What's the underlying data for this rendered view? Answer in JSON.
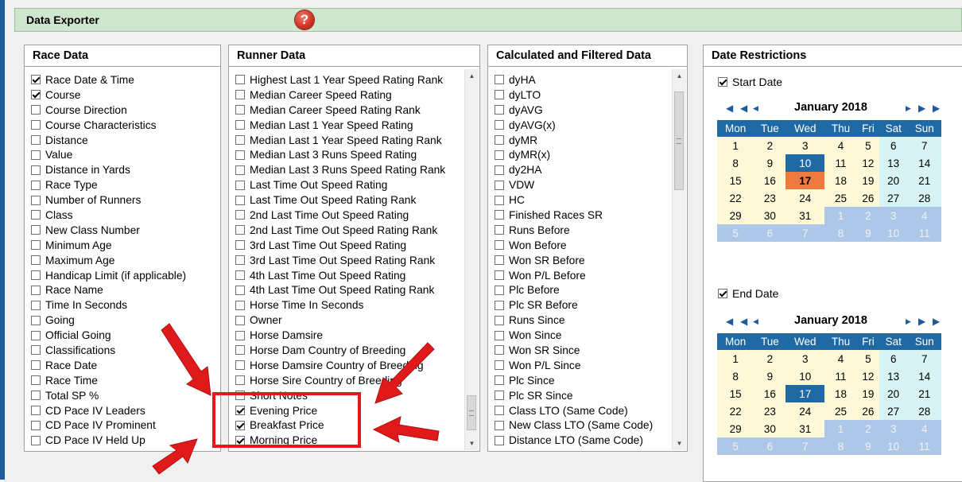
{
  "header": {
    "title": "Data Exporter",
    "help_label": "?"
  },
  "race_data": {
    "title": "Race Data",
    "items": [
      {
        "label": "Race Date & Time",
        "checked": true
      },
      {
        "label": "Course",
        "checked": true
      },
      {
        "label": "Course Direction",
        "checked": false
      },
      {
        "label": "Course Characteristics",
        "checked": false
      },
      {
        "label": "Distance",
        "checked": false
      },
      {
        "label": "Value",
        "checked": false
      },
      {
        "label": "Distance in Yards",
        "checked": false
      },
      {
        "label": "Race Type",
        "checked": false
      },
      {
        "label": "Number of Runners",
        "checked": false
      },
      {
        "label": "Class",
        "checked": false
      },
      {
        "label": "New Class Number",
        "checked": false
      },
      {
        "label": "Minimum Age",
        "checked": false
      },
      {
        "label": "Maximum Age",
        "checked": false
      },
      {
        "label": "Handicap Limit (if applicable)",
        "checked": false
      },
      {
        "label": "Race Name",
        "checked": false
      },
      {
        "label": "Time In Seconds",
        "checked": false
      },
      {
        "label": "Going",
        "checked": false
      },
      {
        "label": "Official Going",
        "checked": false
      },
      {
        "label": "Classifications",
        "checked": false
      },
      {
        "label": "Race Date",
        "checked": false
      },
      {
        "label": "Race Time",
        "checked": false
      },
      {
        "label": "Total SP %",
        "checked": false
      },
      {
        "label": "CD Pace IV Leaders",
        "checked": false
      },
      {
        "label": "CD Pace IV Prominent",
        "checked": false
      },
      {
        "label": "CD Pace IV Held Up",
        "checked": false
      }
    ]
  },
  "runner_data": {
    "title": "Runner Data",
    "items": [
      {
        "label": "Highest Last 1 Year Speed Rating Rank",
        "checked": false
      },
      {
        "label": "Median Career Speed Rating",
        "checked": false
      },
      {
        "label": "Median Career Speed Rating Rank",
        "checked": false
      },
      {
        "label": "Median Last 1 Year Speed Rating",
        "checked": false
      },
      {
        "label": "Median Last 1 Year Speed Rating Rank",
        "checked": false
      },
      {
        "label": "Median Last 3 Runs Speed Rating",
        "checked": false
      },
      {
        "label": "Median Last 3 Runs Speed Rating Rank",
        "checked": false
      },
      {
        "label": "Last Time Out Speed Rating",
        "checked": false
      },
      {
        "label": "Last Time Out Speed Rating Rank",
        "checked": false
      },
      {
        "label": "2nd Last Time Out Speed Rating",
        "checked": false
      },
      {
        "label": "2nd Last Time Out Speed Rating Rank",
        "checked": false
      },
      {
        "label": "3rd Last Time Out Speed Rating",
        "checked": false
      },
      {
        "label": "3rd Last Time Out Speed Rating Rank",
        "checked": false
      },
      {
        "label": "4th Last Time Out Speed Rating",
        "checked": false
      },
      {
        "label": "4th Last Time Out Speed Rating Rank",
        "checked": false
      },
      {
        "label": "Horse Time In Seconds",
        "checked": false
      },
      {
        "label": "Owner",
        "checked": false
      },
      {
        "label": "Horse Damsire",
        "checked": false
      },
      {
        "label": "Horse Dam Country of Breeding",
        "checked": false
      },
      {
        "label": "Horse Damsire Country of Breeding",
        "checked": false
      },
      {
        "label": "Horse Sire Country of Breeding",
        "checked": false
      },
      {
        "label": "Short Notes",
        "checked": false
      },
      {
        "label": "Evening Price",
        "checked": true
      },
      {
        "label": "Breakfast Price",
        "checked": true
      },
      {
        "label": "Morning Price",
        "checked": true
      }
    ]
  },
  "calc_data": {
    "title": "Calculated and Filtered Data",
    "items": [
      {
        "label": "dyHA",
        "checked": false
      },
      {
        "label": "dyLTO",
        "checked": false
      },
      {
        "label": "dyAVG",
        "checked": false
      },
      {
        "label": "dyAVG(x)",
        "checked": false
      },
      {
        "label": "dyMR",
        "checked": false
      },
      {
        "label": "dyMR(x)",
        "checked": false
      },
      {
        "label": "dy2HA",
        "checked": false
      },
      {
        "label": "VDW",
        "checked": false
      },
      {
        "label": "HC",
        "checked": false
      },
      {
        "label": "Finished Races SR",
        "checked": false
      },
      {
        "label": "Runs Before",
        "checked": false
      },
      {
        "label": "Won Before",
        "checked": false
      },
      {
        "label": "Won SR Before",
        "checked": false
      },
      {
        "label": "Won P/L Before",
        "checked": false
      },
      {
        "label": "Plc Before",
        "checked": false
      },
      {
        "label": "Plc SR Before",
        "checked": false
      },
      {
        "label": "Runs Since",
        "checked": false
      },
      {
        "label": "Won Since",
        "checked": false
      },
      {
        "label": "Won SR Since",
        "checked": false
      },
      {
        "label": "Won P/L Since",
        "checked": false
      },
      {
        "label": "Plc Since",
        "checked": false
      },
      {
        "label": "Plc SR Since",
        "checked": false
      },
      {
        "label": "Class LTO (Same Code)",
        "checked": false
      },
      {
        "label": "New Class LTO (Same Code)",
        "checked": false
      },
      {
        "label": "Distance LTO (Same Code)",
        "checked": false
      }
    ]
  },
  "date_restrictions": {
    "title": "Date Restrictions",
    "start": {
      "label": "Start Date",
      "checked": true,
      "month": "January 2018",
      "selected": "10",
      "today": "17"
    },
    "end": {
      "label": "End Date",
      "checked": true,
      "month": "January 2018",
      "selected": "17",
      "today": ""
    },
    "weekdays": [
      "Mon",
      "Tue",
      "Wed",
      "Thu",
      "Fri",
      "Sat",
      "Sun"
    ],
    "weeks": [
      [
        {
          "d": "1",
          "o": false
        },
        {
          "d": "2",
          "o": false
        },
        {
          "d": "3",
          "o": false
        },
        {
          "d": "4",
          "o": false
        },
        {
          "d": "5",
          "o": false
        },
        {
          "d": "6",
          "o": false
        },
        {
          "d": "7",
          "o": false
        }
      ],
      [
        {
          "d": "8",
          "o": false
        },
        {
          "d": "9",
          "o": false
        },
        {
          "d": "10",
          "o": false
        },
        {
          "d": "11",
          "o": false
        },
        {
          "d": "12",
          "o": false
        },
        {
          "d": "13",
          "o": false
        },
        {
          "d": "14",
          "o": false
        }
      ],
      [
        {
          "d": "15",
          "o": false
        },
        {
          "d": "16",
          "o": false
        },
        {
          "d": "17",
          "o": false
        },
        {
          "d": "18",
          "o": false
        },
        {
          "d": "19",
          "o": false
        },
        {
          "d": "20",
          "o": false
        },
        {
          "d": "21",
          "o": false
        }
      ],
      [
        {
          "d": "22",
          "o": false
        },
        {
          "d": "23",
          "o": false
        },
        {
          "d": "24",
          "o": false
        },
        {
          "d": "25",
          "o": false
        },
        {
          "d": "26",
          "o": false
        },
        {
          "d": "27",
          "o": false
        },
        {
          "d": "28",
          "o": false
        }
      ],
      [
        {
          "d": "29",
          "o": false
        },
        {
          "d": "30",
          "o": false
        },
        {
          "d": "31",
          "o": false
        },
        {
          "d": "1",
          "o": true
        },
        {
          "d": "2",
          "o": true
        },
        {
          "d": "3",
          "o": true
        },
        {
          "d": "4",
          "o": true
        }
      ],
      [
        {
          "d": "5",
          "o": true
        },
        {
          "d": "6",
          "o": true
        },
        {
          "d": "7",
          "o": true
        },
        {
          "d": "8",
          "o": true
        },
        {
          "d": "9",
          "o": true
        },
        {
          "d": "10",
          "o": true
        },
        {
          "d": "11",
          "o": true
        }
      ]
    ]
  },
  "colors": {
    "accent": "#1f6aa5",
    "annotation": "#e0191b",
    "today": "#ee7a40"
  }
}
